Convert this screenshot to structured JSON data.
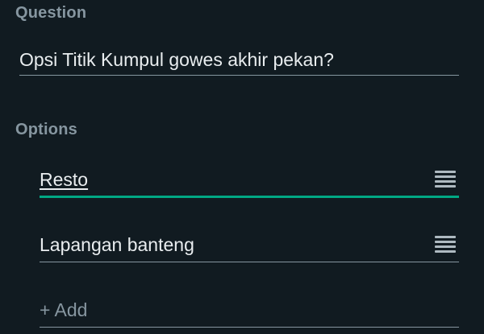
{
  "question": {
    "label": "Question",
    "value": "Opsi Titik Kumpul gowes akhir pekan?"
  },
  "options": {
    "label": "Options",
    "items": [
      {
        "value": "Resto"
      },
      {
        "value": "Lapangan banteng"
      }
    ],
    "add_placeholder": "+ Add"
  },
  "colors": {
    "background": "#111b21",
    "label": "#8696a0",
    "text": "#e9edef",
    "accent": "#00a884"
  },
  "icons": {
    "drag": "drag-handle-icon"
  }
}
